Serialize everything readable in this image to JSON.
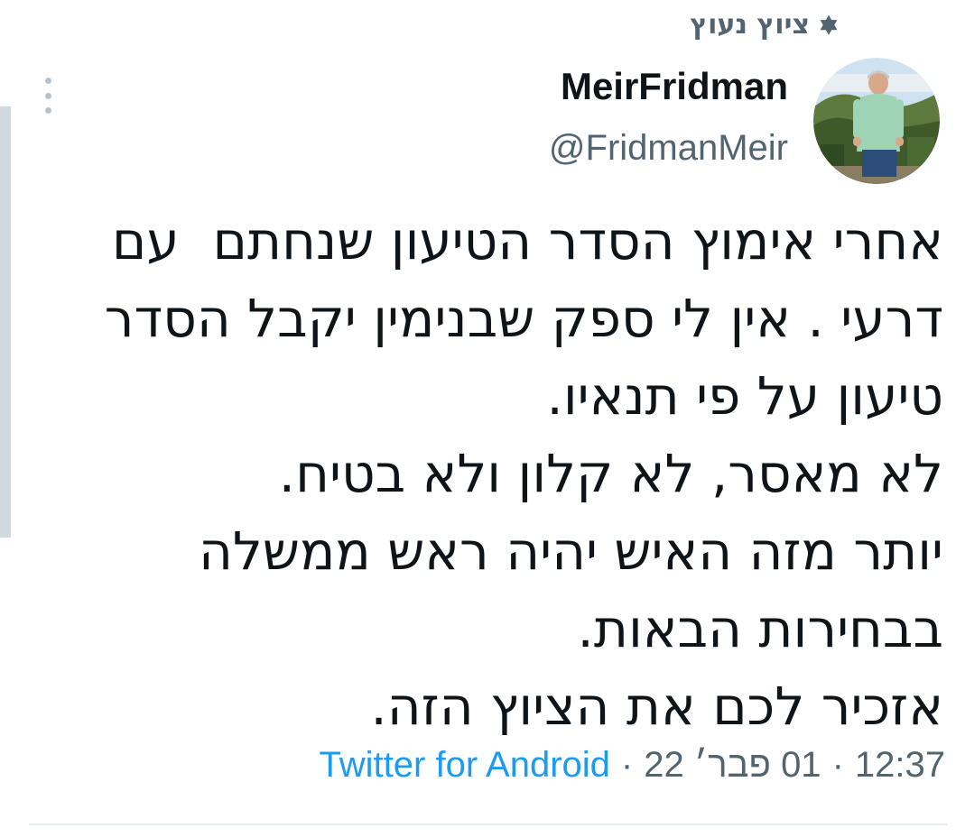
{
  "pinned": {
    "label": "ציוץ נעוץ",
    "icon": "pin-icon"
  },
  "author": {
    "display_name": "MeirFridman",
    "handle": "@FridmanMeir",
    "avatar_icon": "avatar-photo"
  },
  "tweet": {
    "lines": [
      "אחרי אימוץ הסדר הטיעון שנחתם  עם",
      "דרעי . אין לי ספק שבנימין יקבל הסדר",
      "טיעון על פי תנאיו.",
      "לא מאסר, לא קלון ולא בטיח.",
      "יותר מזה האיש יהיה ראש ממשלה",
      "בבחירות הבאות.",
      "אזכיר לכם את הציוץ הזה."
    ]
  },
  "meta": {
    "time": "12:37",
    "date": "01 פבר׳ 22",
    "separator": "·",
    "source": "Twitter for Android"
  },
  "colors": {
    "text_primary": "#0f1419",
    "text_secondary": "#536471",
    "link": "#1d9bf0",
    "divider": "#e6ecf0"
  },
  "menu": {
    "icon": "more-vertical-icon"
  }
}
